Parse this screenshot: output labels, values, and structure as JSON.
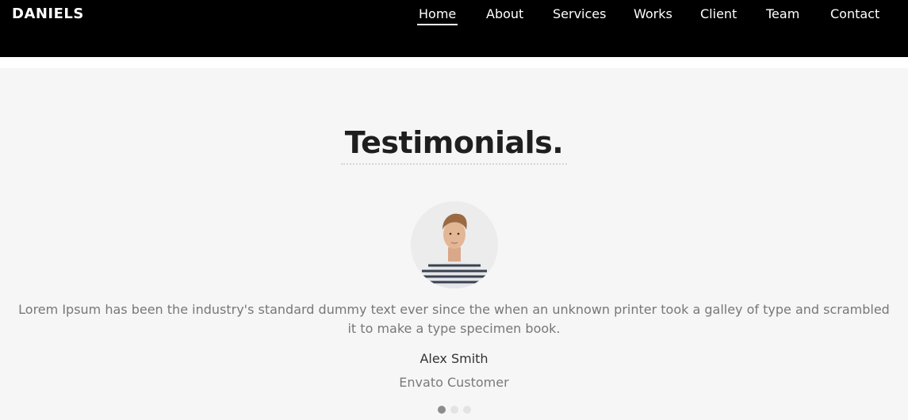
{
  "brand": "DANIELS",
  "nav": {
    "items": [
      {
        "label": "Home",
        "active": true
      },
      {
        "label": "About"
      },
      {
        "label": "Services"
      },
      {
        "label": "Works"
      },
      {
        "label": "Client"
      },
      {
        "label": "Team"
      },
      {
        "label": "Contact"
      }
    ]
  },
  "testimonials": {
    "heading": "Testimonials.",
    "quote": "Lorem Ipsum has been the industry's standard dummy text ever since the when an unknown printer took a galley of type and scrambled it to make a type specimen book.",
    "author": "Alex Smith",
    "role": "Envato Customer",
    "slide_count": 3,
    "active_slide": 1
  },
  "colors": {
    "navbar_bg": "#000000",
    "section_bg": "#f6f6f6",
    "text_dark": "#1f1f1f",
    "text_muted": "#777777"
  }
}
